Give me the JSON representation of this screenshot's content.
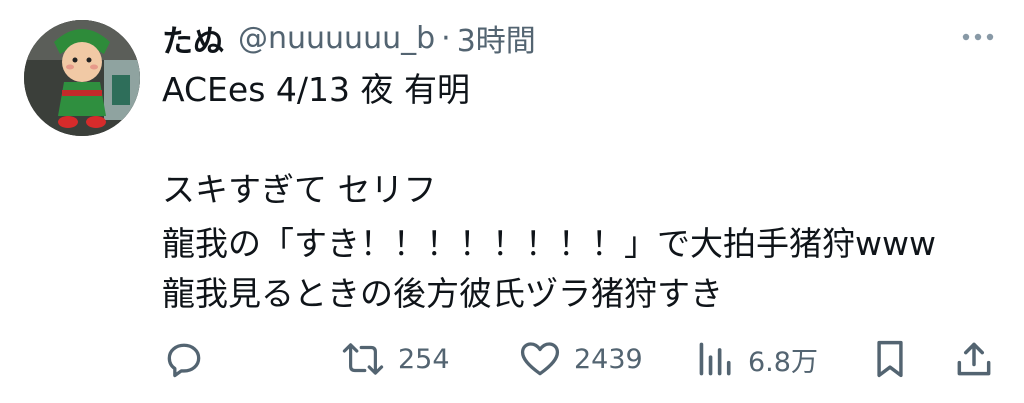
{
  "tweet": {
    "author_name": "たぬ",
    "handle": "@nuuuuuu_b",
    "separator": "·",
    "time": "3時間",
    "lines": [
      "ACEes 4/13 夜 有明",
      "",
      "スキすぎて セリフ",
      "龍我の「すき！！！！！！！！」で大拍手猪狩www",
      "龍我見るときの後方彼氏ヅラ猪狩すき"
    ]
  },
  "actions": {
    "reply_icon": "reply-icon",
    "retweet_count": "254",
    "like_count": "2439",
    "view_count": "6.8万"
  },
  "colors": {
    "text": "#0f1419",
    "secondary": "#536471",
    "background": "#ffffff"
  }
}
